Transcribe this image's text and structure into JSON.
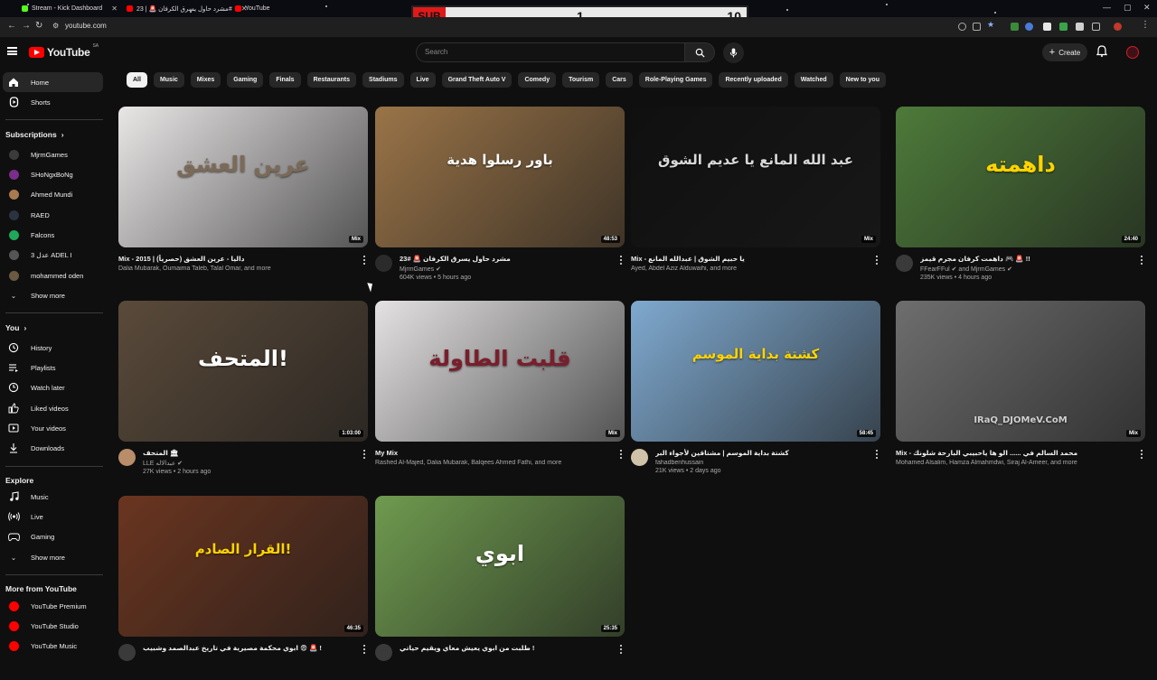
{
  "browser": {
    "tabs": [
      {
        "title": "Stream - Kick Dashboard",
        "color": "#53fc18"
      },
      {
        "title": "مشرد حاول يسرق الكرفان 🚨 | 23#",
        "color": "#ff0000"
      },
      {
        "title": "YouTube",
        "color": "#ff0000"
      }
    ],
    "url": "youtube.com"
  },
  "overlay": {
    "label": "SUB",
    "current": "1",
    "goal": "10"
  },
  "masthead": {
    "logo_text": "YouTube",
    "country": "SA",
    "search_placeholder": "Search",
    "create_label": "Create"
  },
  "sidebar": {
    "main": [
      {
        "label": "Home",
        "icon": "home-icon"
      },
      {
        "label": "Shorts",
        "icon": "shorts-icon"
      }
    ],
    "subscriptions_title": "Subscriptions",
    "subscriptions": [
      {
        "label": "MjrmGames",
        "color": "#3b3b3b"
      },
      {
        "label": "SHoNgxBoNg",
        "color": "#7a2d8a"
      },
      {
        "label": "Ahmed Mundi",
        "color": "#a87b4f"
      },
      {
        "label": "RAED",
        "color": "#2a3340"
      },
      {
        "label": "Falcons",
        "color": "#1fa85a"
      },
      {
        "label": "3 عدل ADEL I",
        "color": "#555"
      },
      {
        "label": "mohammed oden",
        "color": "#6b5a43"
      }
    ],
    "show_more": "Show more",
    "you_title": "You",
    "you": [
      {
        "label": "History",
        "icon": "history-icon"
      },
      {
        "label": "Playlists",
        "icon": "playlists-icon"
      },
      {
        "label": "Watch later",
        "icon": "watch-later-icon"
      },
      {
        "label": "Liked videos",
        "icon": "liked-icon"
      },
      {
        "label": "Your videos",
        "icon": "your-videos-icon"
      },
      {
        "label": "Downloads",
        "icon": "download-icon"
      }
    ],
    "explore_title": "Explore",
    "explore": [
      {
        "label": "Music",
        "icon": "music-icon"
      },
      {
        "label": "Live",
        "icon": "live-icon"
      },
      {
        "label": "Gaming",
        "icon": "gaming-icon"
      },
      {
        "label": "Show more",
        "icon": "chevron-down-icon"
      }
    ],
    "more_title": "More from YouTube",
    "more": [
      {
        "label": "YouTube Premium"
      },
      {
        "label": "YouTube Studio"
      },
      {
        "label": "YouTube Music"
      }
    ]
  },
  "chips": [
    "All",
    "Music",
    "Mixes",
    "Gaming",
    "Finals",
    "Restaurants",
    "Stadiums",
    "Live",
    "Grand Theft Auto V",
    "Comedy",
    "Tourism",
    "Cars",
    "Role-Playing Games",
    "Recently uploaded",
    "Watched",
    "New to you"
  ],
  "videos": [
    {
      "title": "Mix - 2015 | داليا - عرين العشق (حصرياً)",
      "channel": "Dalia Mubarak, Oumaima Taleb, Talal Omar, and more",
      "stats": "",
      "badge": "Mix",
      "thumb_text": "عرين العشق",
      "thumb_bg": "#e9e6e6",
      "thumb_fg": "#7b6a58",
      "avatar": ""
    },
    {
      "title": "23# 🚨 مشرد حاول يسرق الكرفان",
      "channel": "MjrmGames ✔",
      "stats": "604K views • 5 hours ago",
      "badge": "48:53",
      "thumb_text": "باور رسلوا هدية",
      "thumb_bg": "#9a7448",
      "thumb_fg": "#ffffff",
      "avatar": "#2b2b2b"
    },
    {
      "title": "Mix - يا حبيم الشوق | عبدالله المانع",
      "channel": "Ayed, Abdel Aziz Alduwaihi, and more",
      "stats": "",
      "badge": "Mix",
      "thumb_text": "عبد الله المانع يا عديم الشوق",
      "thumb_bg": "#101010",
      "thumb_fg": "#d8d8d8",
      "avatar": ""
    },
    {
      "title": "داهمت كرفان مجرم قيمز 🎮 🚨 !!",
      "channel": "FFearFFul ✔ and MjrmGames ✔",
      "stats": "235K views • 4 hours ago",
      "badge": "24:40",
      "thumb_text": "داهمته",
      "thumb_bg": "#4d7a3a",
      "thumb_fg": "#ffd400",
      "avatar": "#3a3a3a"
    },
    {
      "title": "المتحف 🏛",
      "channel": "LLE عبدالاله ✔",
      "stats": "27K views • 2 hours ago",
      "badge": "1:03:00",
      "thumb_text": "المتحف!",
      "thumb_bg": "#5a4a3a",
      "thumb_fg": "#ffffff",
      "avatar": "#b98c6a"
    },
    {
      "title": "My Mix",
      "channel": "Rashed Al-Majed, Dalia Mubarak, Balqees Ahmed Fathi, and more",
      "stats": "",
      "badge": "Mix",
      "thumb_text": "قلبت الطاولة",
      "thumb_bg": "#e4e2e2",
      "thumb_fg": "#7a1e2c",
      "avatar": ""
    },
    {
      "title": "كشتة بداية الموسم | مشتاقين لأجواء البر",
      "channel": "fahadbenhussain",
      "stats": "21K views • 2 days ago",
      "badge": "58:45",
      "thumb_text": "كشتة بداية الموسم",
      "thumb_bg": "#7fa9cf",
      "thumb_fg": "#ffd400",
      "avatar": "#cfc2a8"
    },
    {
      "title": "Mix - محمد السالم في ...... الو ها ياحبيبي البارحة شلونك",
      "channel": "Mohamed Alsalim, Hamza Almahmdwi, Siraj Al-Ameer, and more",
      "stats": "",
      "badge": "Mix",
      "thumb_text": "IRaQ_DJOMeV.CoM",
      "thumb_bg": "#6e6e6e",
      "thumb_fg": "#d0d0d0",
      "avatar": ""
    },
    {
      "title": "ابوي محكمة مصيرية في تاريخ عبدالصمد وشبيب 😨 🚨 !",
      "channel": "",
      "stats": "",
      "badge": "46:35",
      "thumb_text": "القرار الصادم!",
      "thumb_bg": "#6a3520",
      "thumb_fg": "#ffd400",
      "avatar": "#3a3a3a"
    },
    {
      "title": "طلبت من ابوي يعيش معاي ويقيم حياتي !",
      "channel": "",
      "stats": "",
      "badge": "25:35",
      "thumb_text": "ابوي",
      "thumb_bg": "#6f9a4f",
      "thumb_fg": "#ffffff",
      "avatar": "#3a3a3a"
    }
  ]
}
